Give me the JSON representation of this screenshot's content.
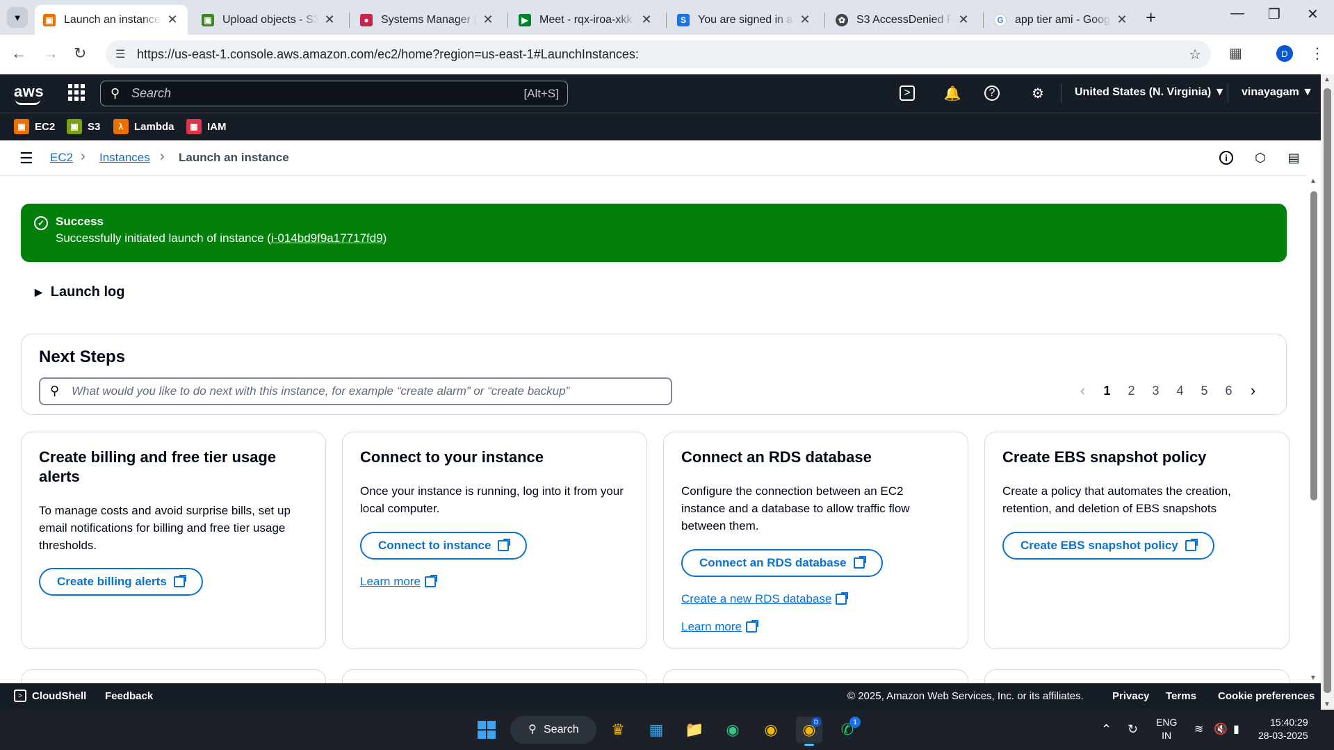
{
  "browser": {
    "tabs": [
      {
        "title": "Launch an instance | E",
        "active": true
      },
      {
        "title": "Upload objects - S3 b"
      },
      {
        "title": "Systems Manager | us"
      },
      {
        "title": "Meet - rqx-iroa-xkk"
      },
      {
        "title": "You are signed in as"
      },
      {
        "title": "S3 AccessDenied Res"
      },
      {
        "title": "app tier ami - Google"
      }
    ],
    "url": "https://us-east-1.console.aws.amazon.com/ec2/home?region=us-east-1#LaunchInstances:",
    "profile_initial": "D"
  },
  "aws_header": {
    "logo": "aws",
    "search_placeholder": "Search",
    "search_shortcut": "[Alt+S]",
    "region": "United States (N. Virginia)",
    "user": "vinayagam"
  },
  "favorites": [
    {
      "label": "EC2",
      "color": "#ed7100"
    },
    {
      "label": "S3",
      "color": "#7aa116"
    },
    {
      "label": "Lambda",
      "color": "#ed7100"
    },
    {
      "label": "IAM",
      "color": "#dd344c"
    }
  ],
  "breadcrumb": {
    "items": [
      "EC2",
      "Instances"
    ],
    "current": "Launch an instance"
  },
  "flash": {
    "title": "Success",
    "message_prefix": "Successfully initiated launch of instance (",
    "instance_id": "i-014bd9f9a17717fd9",
    "message_suffix": ")",
    "color": "#037f0c"
  },
  "launch_log": "Launch log",
  "next_steps": {
    "title": "Next Steps",
    "placeholder": "What would you like to do next with this instance, for example “create alarm” or “create backup”",
    "pages": [
      "1",
      "2",
      "3",
      "4",
      "5",
      "6"
    ],
    "current_page": "1"
  },
  "cards": [
    {
      "title": "Create billing and free tier usage alerts",
      "description": "To manage costs and avoid surprise bills, set up email notifications for billing and free tier usage thresholds.",
      "button": "Create billing alerts"
    },
    {
      "title": "Connect to your instance",
      "description": "Once your instance is running, log into it from your local computer.",
      "button": "Connect to instance",
      "link": "Learn more"
    },
    {
      "title": "Connect an RDS database",
      "description": "Configure the connection between an EC2 instance and a database to allow traffic flow between them.",
      "button": "Connect an RDS database",
      "link": "Create a new RDS database",
      "link2": "Learn more"
    },
    {
      "title": "Create EBS snapshot policy",
      "description": "Create a policy that automates the creation, retention, and deletion of EBS snapshots",
      "button": "Create EBS snapshot policy"
    }
  ],
  "footer": {
    "cloudshell": "CloudShell",
    "feedback": "Feedback",
    "copyright": "© 2025, Amazon Web Services, Inc. or its affiliates.",
    "privacy": "Privacy",
    "terms": "Terms",
    "cookies": "Cookie preferences"
  },
  "taskbar": {
    "search": "Search",
    "lang_top": "ENG",
    "lang_bottom": "IN",
    "time": "15:40:29",
    "date": "28-03-2025",
    "chrome_badge": "D",
    "whatsapp_badge": "1"
  }
}
